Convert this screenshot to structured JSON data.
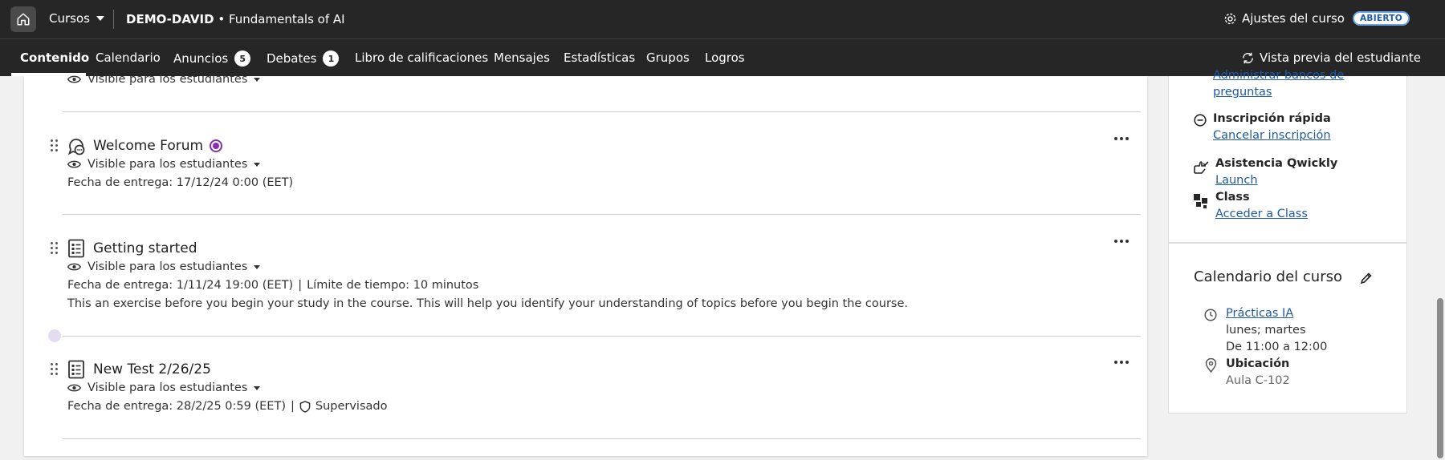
{
  "topbar": {
    "cursos_label": "Cursos",
    "course_code": "DEMO-DAVID",
    "course_sep": " • ",
    "course_name": "Fundamentals of AI",
    "settings_label": "Ajustes del curso",
    "status_badge": "ABIERTO"
  },
  "nav": {
    "tabs": [
      {
        "label": "Contenido"
      },
      {
        "label": "Calendario"
      },
      {
        "label": "Anuncios",
        "count": "5"
      },
      {
        "label": "Debates",
        "count": "1"
      },
      {
        "label": "Libro de calificaciones"
      },
      {
        "label": "Mensajes"
      },
      {
        "label": "Estadísticas"
      },
      {
        "label": "Grupos"
      },
      {
        "label": "Logros"
      }
    ],
    "preview_label": "Vista previa del estudiante"
  },
  "content": {
    "visible_label": "Visible para los estudiantes",
    "items": [
      {
        "title": "Welcome Forum",
        "due": "Fecha de entrega: 17/12/24 0:00 (EET)"
      },
      {
        "title": "Getting started",
        "due": "Fecha de entrega: 1/11/24 19:00 (EET)",
        "sep": "|",
        "time_limit": "Límite de tiempo: 10 minutos",
        "description": "This an exercise before you begin your study in the course. This will help you identify your understanding of topics before you begin the course."
      },
      {
        "title": "New Test 2/26/25",
        "due": "Fecha de entrega: 28/2/25 0:59 (EET)",
        "sep": "|",
        "proctored": "Supervisado"
      }
    ]
  },
  "sidebar": {
    "question_banks_line1": "Administrar bancos de",
    "question_banks_line2": "preguntas",
    "quick_enroll_label": "Inscripción rápida",
    "quick_enroll_link": "Cancelar inscripción",
    "qwickly_label": "Asistencia Qwickly",
    "qwickly_link": "Launch",
    "class_label": "Class",
    "class_link": "Acceder a Class",
    "calendar": {
      "title": "Calendario del curso",
      "event_link": "Prácticas IA",
      "days": "lunes; martes",
      "time": "De 11:00 a 12:00",
      "location_label": "Ubicación",
      "location_value": "Aula C-102"
    }
  }
}
